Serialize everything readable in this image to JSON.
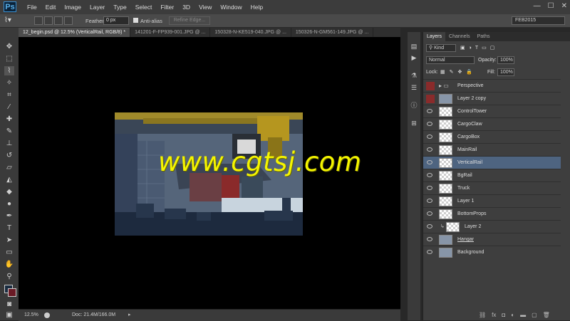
{
  "app": {
    "logo": "Ps"
  },
  "menu": [
    "File",
    "Edit",
    "Image",
    "Layer",
    "Type",
    "Select",
    "Filter",
    "3D",
    "View",
    "Window",
    "Help"
  ],
  "window_controls": [
    "—",
    "☐",
    "✕"
  ],
  "options": {
    "feather_label": "Feather:",
    "feather_value": "0 px",
    "antialias_label": "Anti-alias",
    "refine_edge": "Refine Edge...",
    "workspace": "FEB2015"
  },
  "doc_tabs": [
    "12_begin.psd @ 12.5% (VerticalRail, RGB/8) *",
    "141201-F-FP939-001.JPG @ ...",
    "150328-N-KE519-040.JPG @ ...",
    "150326-N-GM561-149.JPG @ ..."
  ],
  "canvas": {
    "watermark": "www.cgtsj.com"
  },
  "status": {
    "zoom": "12.5%",
    "doc": "Doc: 21.4M/166.0M"
  },
  "panel": {
    "tabs": [
      "Layers",
      "Channels",
      "Paths"
    ],
    "filter_kind": "Kind",
    "blend_mode": "Normal",
    "opacity_label": "Opacity:",
    "opacity_value": "100%",
    "lock_label": "Lock:",
    "fill_label": "Fill:",
    "fill_value": "100%"
  },
  "layers": [
    {
      "name": "Perspective",
      "type": "group"
    },
    {
      "name": "Layer 2 copy",
      "type": "image"
    },
    {
      "name": "ControlTower",
      "type": "transparent"
    },
    {
      "name": "CargoClaw",
      "type": "transparent"
    },
    {
      "name": "CargoBox",
      "type": "transparent"
    },
    {
      "name": "MainRail",
      "type": "transparent"
    },
    {
      "name": "VerticalRail",
      "type": "transparent",
      "selected": true
    },
    {
      "name": "BgRail",
      "type": "transparent"
    },
    {
      "name": "Truck",
      "type": "transparent"
    },
    {
      "name": "Layer 1",
      "type": "transparent"
    },
    {
      "name": "BottomProps",
      "type": "transparent"
    },
    {
      "name": "Layer 2",
      "type": "clipped"
    },
    {
      "name": "Hangar",
      "type": "image"
    },
    {
      "name": "Background",
      "type": "image"
    }
  ]
}
